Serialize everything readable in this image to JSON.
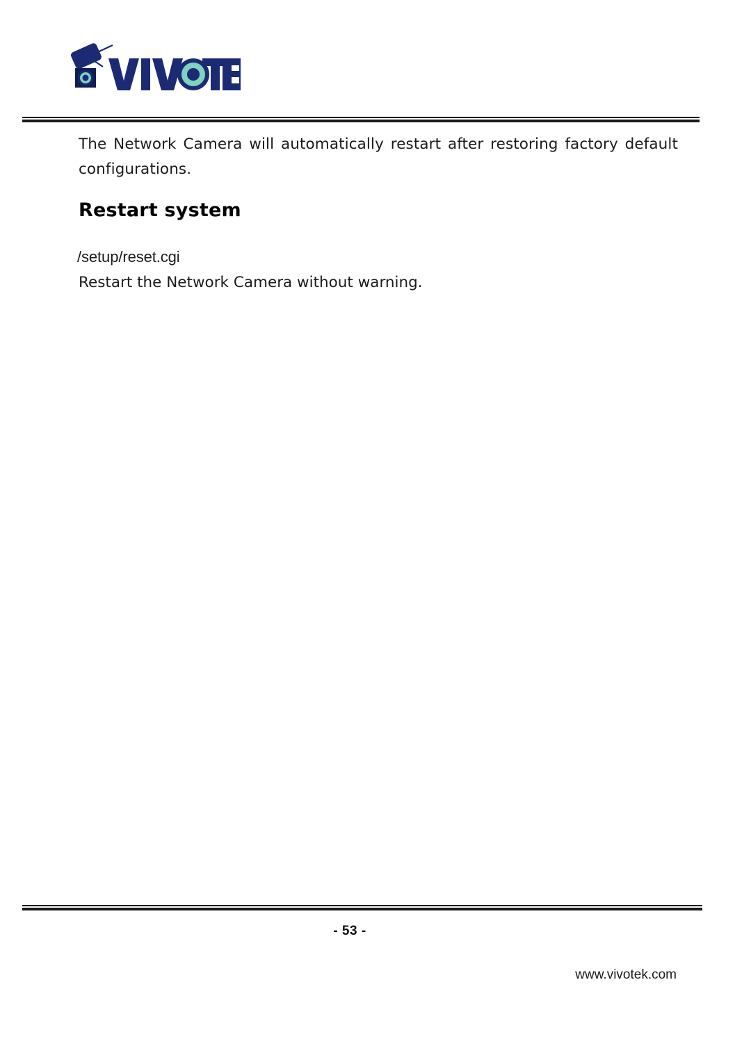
{
  "document": {
    "page_label": "- 53 -",
    "site_url": "www.vivotek.com"
  },
  "header": {
    "logo": {
      "wordmark": "VIVOTEK",
      "icon_name": "vivotek-camera-logo",
      "navy": "#1b2a73",
      "dark_navy": "#141d4f",
      "lens_teal": "#7fd1c0",
      "lens_ring": "#1b2a73"
    }
  },
  "content": {
    "intro_paragraph": "The Network Camera will automatically restart after restoring factory default configurations.",
    "section_heading": "Restart system",
    "cgi_path": "/setup/reset.cgi",
    "cgi_description": "Restart the Network Camera without warning."
  }
}
